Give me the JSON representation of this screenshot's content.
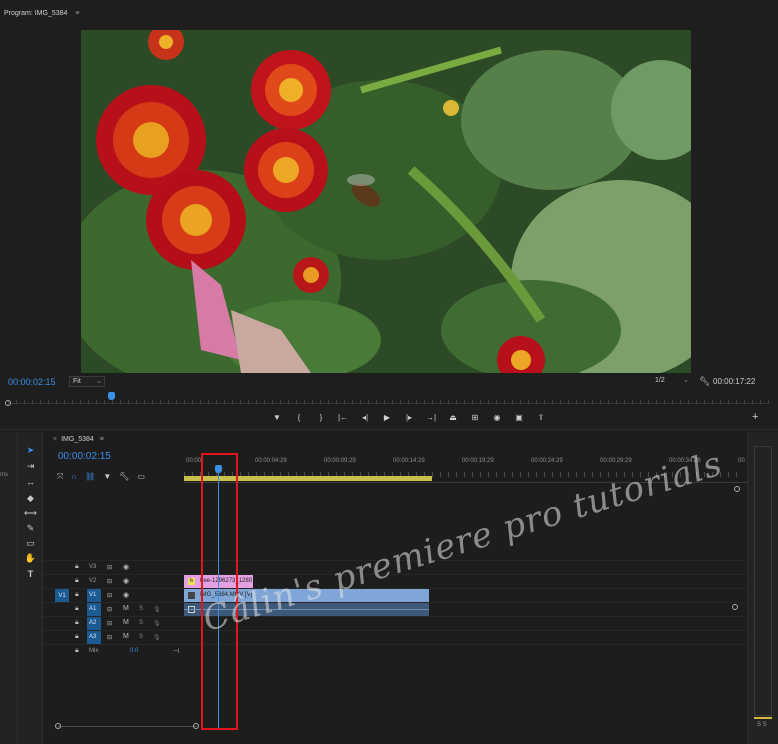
{
  "program_monitor": {
    "title": "Program: IMG_5384",
    "menu_icon": "hamburger-icon",
    "current_time": "00:00:02:15",
    "fit": "Fit",
    "resolution": "1/2",
    "duration": "00:00:17:22",
    "transport_icons": [
      "marker-icon",
      "mark-in-icon",
      "mark-out-icon",
      "go-to-in-icon",
      "step-back-icon",
      "play-icon",
      "step-forward-icon",
      "go-to-out-icon",
      "lift-icon",
      "extract-icon",
      "export-frame-icon",
      "compare-icon",
      "insert-icon"
    ]
  },
  "timeline": {
    "sequence_name": "IMG_5384",
    "current_time": "00:00:02:15",
    "ruler_labels": [
      "00:00",
      "00:00:04:29",
      "00:00:09:29",
      "00:00:14:29",
      "00:00:19:29",
      "00:00:24:29",
      "00:00:29:29",
      "00:00:34:29",
      "00"
    ],
    "tracks": [
      {
        "name": "V3",
        "type": "video"
      },
      {
        "name": "V2",
        "type": "video"
      },
      {
        "name": "V1",
        "type": "video",
        "source": "V1"
      },
      {
        "name": "A1",
        "type": "audio"
      },
      {
        "name": "A2",
        "type": "audio"
      },
      {
        "name": "A3",
        "type": "audio"
      }
    ],
    "mix": {
      "label": "Mix",
      "value": "0.0"
    },
    "clips": {
      "title_clip": "bee-1296273_1280",
      "video_clip": "IMG_5384.MOV [V]"
    },
    "audio_letters": {
      "mute": "M",
      "solo": "S"
    }
  },
  "left_strip": {
    "label": "ms"
  },
  "meter": {
    "label": "S S"
  },
  "watermark": "Câlin's premiere pro tutorials",
  "colors": {
    "accent": "#3b8fe6",
    "highlight": "#e0161c",
    "title_clip": "#e4a0e3",
    "video_clip": "#7fa6d6",
    "work_area": "#c9c24a"
  }
}
